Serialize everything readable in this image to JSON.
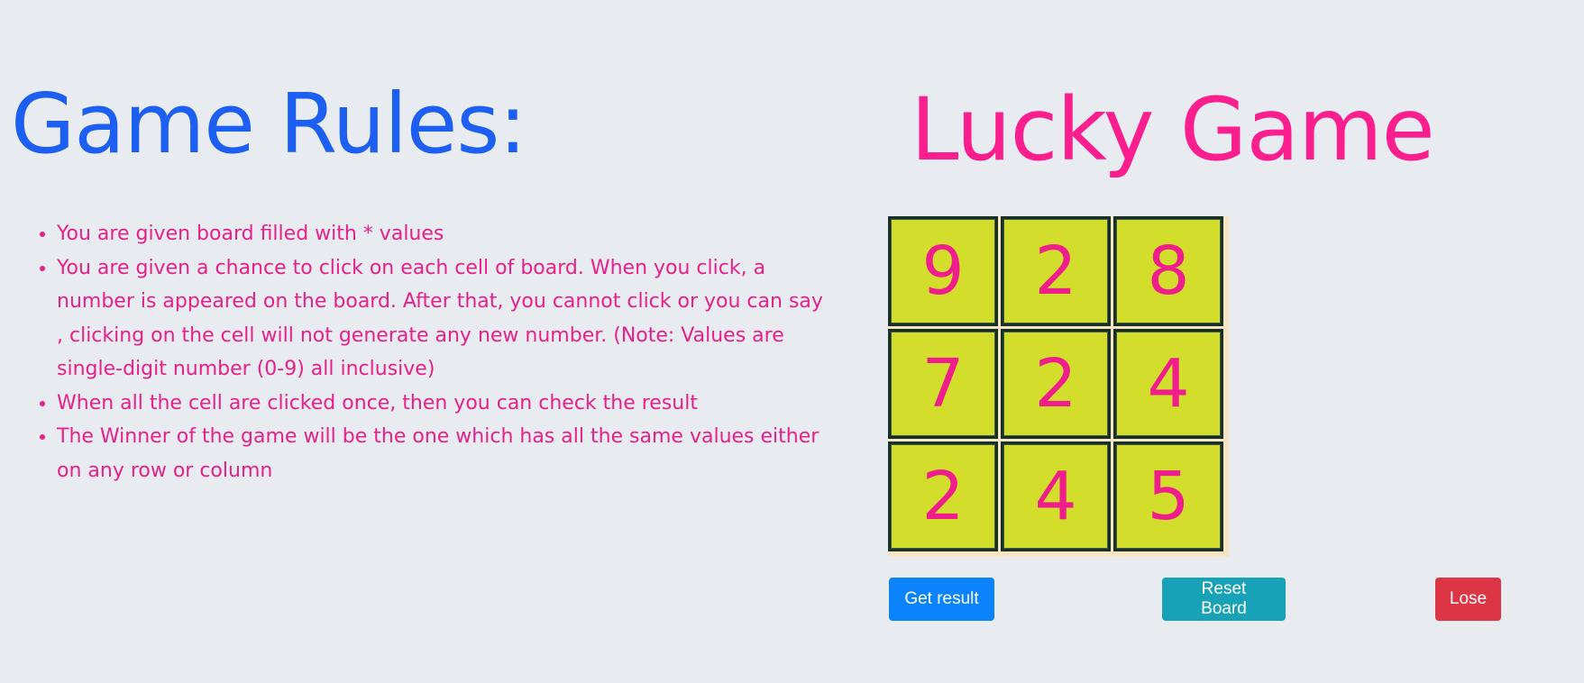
{
  "rules": {
    "title": "Game Rules:",
    "items": [
      "You are given board filled with * values",
      "You are given a chance to click on each cell of board. When you click, a number is appeared on the board. After that, you cannot click or you can say , clicking on the cell will not generate any new number. (Note: Values are single-digit number (0-9) all inclusive)",
      "When all the cell are clicked once, then you can check the result",
      "The Winner of the game will be the one which has all the same values either on any row or column"
    ]
  },
  "game": {
    "title": "Lucky Game",
    "board": [
      [
        "9",
        "2",
        "8"
      ],
      [
        "7",
        "2",
        "4"
      ],
      [
        "2",
        "4",
        "5"
      ]
    ]
  },
  "buttons": {
    "get_result": "Get result",
    "reset_board": "Reset Board",
    "lose": "Lose"
  },
  "colors": {
    "background": "#e8ebef",
    "rules_title": "#1d5ff2",
    "pink_text": "#e8208b",
    "game_title": "#fb1e8e",
    "cell_fill": "#d3dd2b",
    "cell_border": "#172f24",
    "board_bg": "#f7e4c2",
    "get_result_button": "#0a83fb",
    "reset_board_button": "#18a2b8",
    "lose_button": "#dc3545"
  }
}
